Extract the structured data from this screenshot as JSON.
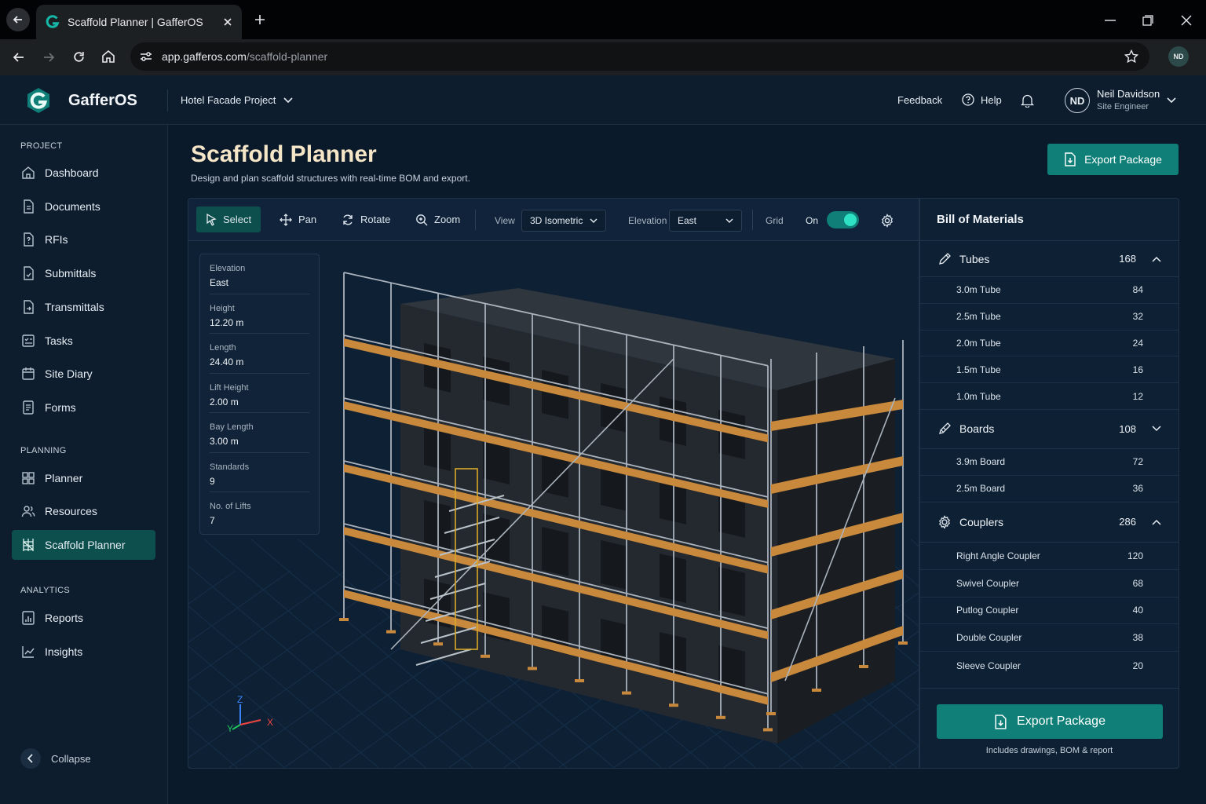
{
  "browser": {
    "tab_title": "Scaffold Planner | GafferOS",
    "url_host": "app.gafferos.com",
    "url_path": "/scaffold-planner",
    "profile_initials": "ND"
  },
  "header": {
    "brand": "GafferOS",
    "project": "Hotel Facade Project",
    "feedback": "Feedback",
    "help": "Help",
    "user_initials": "ND",
    "user_name": "Neil Davidson",
    "user_role": "Site Engineer"
  },
  "sidebar": {
    "project_label": "PROJECT",
    "project_items": [
      "Dashboard",
      "Documents",
      "RFIs",
      "Submittals",
      "Transmittals",
      "Tasks",
      "Site Diary",
      "Forms"
    ],
    "planning_label": "PLANNING",
    "planning_items": [
      "Planner",
      "Resources",
      "Scaffold Planner"
    ],
    "analytics_label": "ANALYTICS",
    "analytics_items": [
      "Reports",
      "Insights"
    ],
    "collapse": "Collapse"
  },
  "page": {
    "title": "Scaffold Planner",
    "subtitle": "Design and plan scaffold structures with real-time BOM and export.",
    "export_button": "Export Package"
  },
  "toolbar": {
    "select": "Select",
    "pan": "Pan",
    "rotate": "Rotate",
    "zoom": "Zoom",
    "view_label": "View",
    "view_value": "3D Isometric",
    "elevation_label": "Elevation",
    "elevation_value": "East",
    "grid_label": "Grid",
    "grid_state": "On"
  },
  "properties": [
    {
      "key": "Elevation",
      "value": "East"
    },
    {
      "key": "Height",
      "value": "12.20 m"
    },
    {
      "key": "Length",
      "value": "24.40 m"
    },
    {
      "key": "Lift Height",
      "value": "2.00 m"
    },
    {
      "key": "Bay Length",
      "value": "3.00 m"
    },
    {
      "key": "Standards",
      "value": "9"
    },
    {
      "key": "No. of Lifts",
      "value": "7"
    }
  ],
  "axes": {
    "x": "X",
    "y": "Y",
    "z": "Z"
  },
  "bom": {
    "title": "Bill of Materials",
    "groups": [
      {
        "name": "Tubes",
        "count": "168",
        "items": [
          [
            "3.0m Tube",
            "84"
          ],
          [
            "2.5m Tube",
            "32"
          ],
          [
            "2.0m Tube",
            "24"
          ],
          [
            "1.5m Tube",
            "16"
          ],
          [
            "1.0m Tube",
            "12"
          ]
        ]
      },
      {
        "name": "Boards",
        "count": "108",
        "items": [
          [
            "3.9m Board",
            "72"
          ],
          [
            "2.5m Board",
            "36"
          ]
        ]
      },
      {
        "name": "Couplers",
        "count": "286",
        "items": [
          [
            "Right Angle Coupler",
            "120"
          ],
          [
            "Swivel Coupler",
            "68"
          ],
          [
            "Putlog Coupler",
            "40"
          ],
          [
            "Double Coupler",
            "38"
          ],
          [
            "Sleeve Coupler",
            "20"
          ]
        ]
      }
    ],
    "export_button": "Export Package",
    "export_note": "Includes drawings, BOM & report"
  },
  "colors": {
    "accent": "#0f7f78",
    "toggle": "#14b8a6",
    "board": "#c8893c"
  }
}
